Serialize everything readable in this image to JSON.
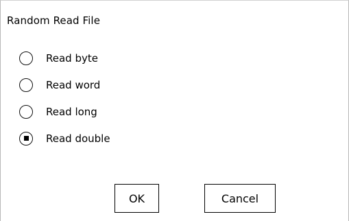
{
  "dialog": {
    "title": "Random Read File",
    "options": [
      {
        "label": "Read byte",
        "selected": false
      },
      {
        "label": "Read word",
        "selected": false
      },
      {
        "label": "Read long",
        "selected": false
      },
      {
        "label": "Read double",
        "selected": true
      }
    ],
    "ok_label": "OK",
    "cancel_label": "Cancel"
  }
}
